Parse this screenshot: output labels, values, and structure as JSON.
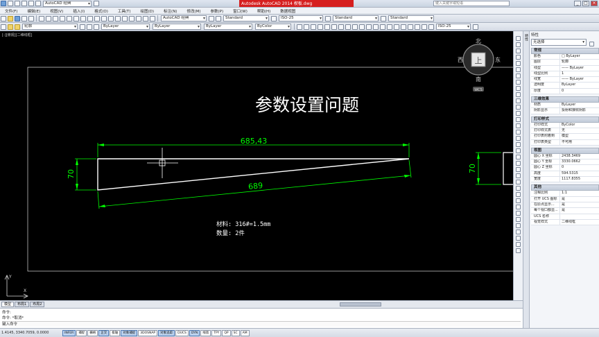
{
  "title_bar": {
    "app_combo": "AutoCAD 经典",
    "center_title": "Autodesk AutoCAD 2014    楔板.dwg",
    "search_placeholder": "键入关键字或短语"
  },
  "menu": [
    "文件(F)",
    "编辑(E)",
    "视图(V)",
    "插入(I)",
    "格式(O)",
    "工具(T)",
    "绘图(D)",
    "标注(N)",
    "修改(M)",
    "参数(P)",
    "窗口(W)",
    "帮助(H)",
    "数据视图"
  ],
  "toolbar1": {
    "workspace": "AutoCAD 经典",
    "text_style": "Standard",
    "dim_style": "ISO-25",
    "table_style": "Standard",
    "mleader_style": "Standard"
  },
  "toolbar2": {
    "layer": "轮廓",
    "color": "ByLayer",
    "linetype": "ByLayer",
    "lineweight": "ByLayer",
    "plotstyle": "ByColor",
    "dim_style2": "ISO-25"
  },
  "viewport_label": "[-][俯视][二维线框]",
  "viewcube": {
    "north": "北",
    "south": "南",
    "east": "东",
    "west": "西",
    "top": "上",
    "ucs": "WCS"
  },
  "drawing": {
    "title": "参数设置问题",
    "dim_top": "685,43",
    "dim_bottom": "689",
    "dim_left": "70",
    "dim_right": "70",
    "note_material": "材料: 316#=1.5mm",
    "note_quantity": "数量: 2件",
    "colors": {
      "dim": "#00ff00",
      "geometry": "#ffffff",
      "border": "#ffffff"
    }
  },
  "tabs": [
    "模型",
    "布局1",
    "布局2"
  ],
  "command": {
    "line1": "命令:",
    "line2": "命令: *取消*",
    "prompt": "键入命令"
  },
  "status": {
    "coords": "1.4145, 3340.7059, 0.0000",
    "buttons": [
      "INFER",
      "捕捉",
      "栅格",
      "正交",
      "极轴",
      "对象捕捉",
      "3DOSNAP",
      "对象追踪",
      "DUCS",
      "DYN",
      "线宽",
      "TPY",
      "QP",
      "SC",
      "AM"
    ]
  },
  "properties": {
    "palette_label": "特性",
    "selection": "无选择",
    "sections": [
      {
        "name": "常规",
        "rows": [
          [
            "颜色",
            "□ ByLayer"
          ],
          [
            "图层",
            "轮廓"
          ],
          [
            "线型",
            "—— ByLayer"
          ],
          [
            "线型比例",
            "1"
          ],
          [
            "线宽",
            "—— ByLayer"
          ],
          [
            "透明度",
            "ByLayer"
          ],
          [
            "厚度",
            "0"
          ]
        ]
      },
      {
        "name": "三维效果",
        "rows": [
          [
            "材质",
            "ByLayer"
          ],
          [
            "阴影显示",
            "投射和接收阴影"
          ]
        ]
      },
      {
        "name": "打印样式",
        "rows": [
          [
            "打印样式",
            "ByColor"
          ],
          [
            "打印样式表",
            "无"
          ],
          [
            "打印表附着到",
            "模型"
          ],
          [
            "打印表类型",
            "不可用"
          ]
        ]
      },
      {
        "name": "视图",
        "rows": [
          [
            "圆心 X 坐标",
            "2438.3469"
          ],
          [
            "圆心 Y 坐标",
            "3330.0662"
          ],
          [
            "圆心 Z 坐标",
            "0"
          ],
          [
            "高度",
            "594.5315"
          ],
          [
            "宽度",
            "1117.8355"
          ]
        ]
      },
      {
        "name": "其他",
        "rows": [
          [
            "注释比例",
            "1:1"
          ],
          [
            "打开 UCS 图标",
            "是"
          ],
          [
            "在原点显示...",
            "是"
          ],
          [
            "每个视口都显...",
            "是"
          ],
          [
            "UCS 名称",
            ""
          ],
          [
            "视觉样式",
            "二维线框"
          ]
        ]
      }
    ]
  }
}
